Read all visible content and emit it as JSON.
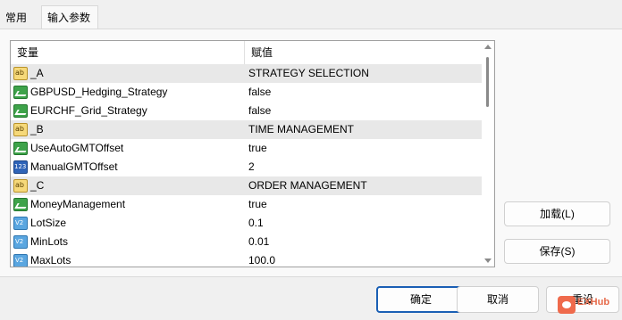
{
  "tabs": [
    {
      "label": "常用",
      "active": false
    },
    {
      "label": "输入参数",
      "active": true
    }
  ],
  "grid": {
    "headers": {
      "name": "变量",
      "value": "赋值"
    },
    "rows": [
      {
        "icon": "ab",
        "name": "_A",
        "value": "STRATEGY SELECTION",
        "separator": true
      },
      {
        "icon": "bool",
        "name": "GBPUSD_Hedging_Strategy",
        "value": "false",
        "separator": false
      },
      {
        "icon": "bool",
        "name": "EURCHF_Grid_Strategy",
        "value": "false",
        "separator": false
      },
      {
        "icon": "ab",
        "name": "_B",
        "value": "TIME MANAGEMENT",
        "separator": true
      },
      {
        "icon": "bool",
        "name": "UseAutoGMTOffset",
        "value": "true",
        "separator": false
      },
      {
        "icon": "num",
        "name": "ManualGMTOffset",
        "value": "2",
        "separator": false
      },
      {
        "icon": "ab",
        "name": "_C",
        "value": "ORDER MANAGEMENT",
        "separator": true
      },
      {
        "icon": "bool",
        "name": "MoneyManagement",
        "value": "true",
        "separator": false
      },
      {
        "icon": "dbl",
        "name": "LotSize",
        "value": "0.1",
        "separator": false
      },
      {
        "icon": "dbl",
        "name": "MinLots",
        "value": "0.01",
        "separator": false
      },
      {
        "icon": "dbl",
        "name": "MaxLots",
        "value": "100.0",
        "separator": false
      }
    ]
  },
  "side_buttons": {
    "load": "加载(L)",
    "save": "保存(S)"
  },
  "bottom_buttons": {
    "ok": "确定",
    "cancel": "取消",
    "reset": "重设"
  },
  "watermark": "EXHub"
}
